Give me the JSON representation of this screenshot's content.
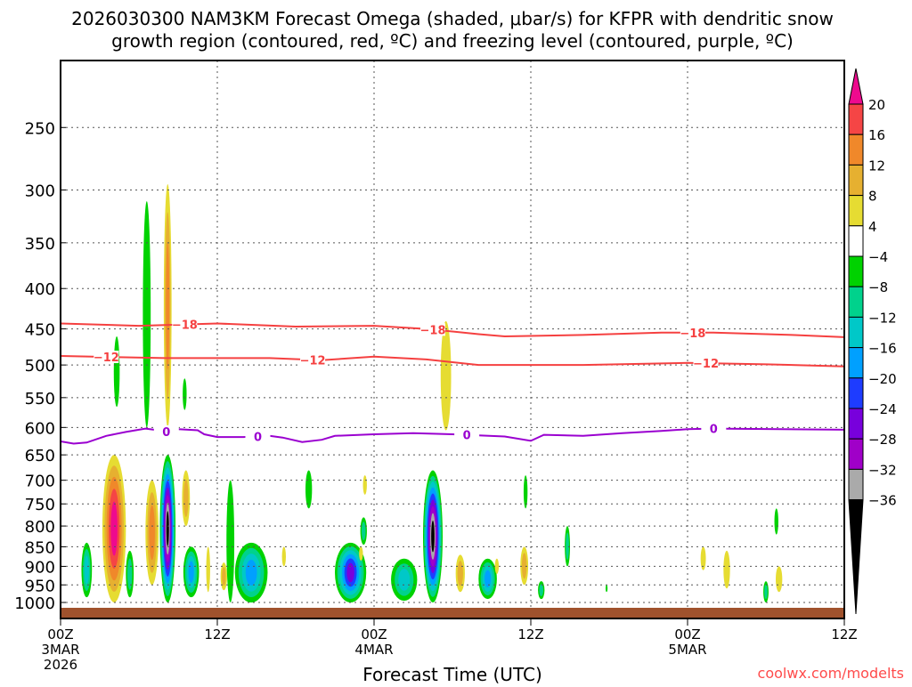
{
  "chart_data": {
    "type": "heatmap",
    "title_line1": "2026030300 NAM3KM Forecast Omega (shaded, μbar/s) for KFPR with dendritic snow",
    "title_line2": "growth region (contoured, red, ºC) and freezing level (contoured, purple, ºC)",
    "xlabel": "Forecast Time (UTC)",
    "xlim_hours": [
      0,
      60
    ],
    "ylim_pressure": [
      1048,
      206
    ],
    "y_ticks": [
      250,
      300,
      350,
      400,
      450,
      500,
      550,
      600,
      650,
      700,
      750,
      800,
      850,
      900,
      950,
      1000
    ],
    "x_ticks": [
      {
        "h": 0,
        "l1": "00Z",
        "l2": "3MAR",
        "l3": "2026"
      },
      {
        "h": 12,
        "l1": "12Z"
      },
      {
        "h": 24,
        "l1": "00Z",
        "l2": "4MAR"
      },
      {
        "h": 36,
        "l1": "12Z"
      },
      {
        "h": 48,
        "l1": "00Z",
        "l2": "5MAR"
      },
      {
        "h": 60,
        "l1": "12Z"
      }
    ],
    "colorbar": {
      "labels": [
        "20",
        "16",
        "12",
        "8",
        "4",
        "-4",
        "-8",
        "-12",
        "-16",
        "-20",
        "-24",
        "-28",
        "-32",
        "-36"
      ],
      "colors": [
        "#ee0a8e",
        "#f54545",
        "#f0882a",
        "#e6b030",
        "#e6dc32",
        "#ffffff",
        "#00d200",
        "#00d28c",
        "#00c8c8",
        "#00a0ff",
        "#1e3cff",
        "#7800dc",
        "#a000c8",
        "#aaaaaa",
        "#000000"
      ]
    },
    "omega_features": [
      {
        "t": 4.1,
        "p1": 650,
        "p2": 1000,
        "w": 1.8,
        "peak": 20
      },
      {
        "t": 2.0,
        "p1": 840,
        "p2": 985,
        "w": 0.8,
        "peak": -12
      },
      {
        "t": 4.3,
        "p1": 460,
        "p2": 565,
        "w": 0.45,
        "peak": -4
      },
      {
        "t": 5.3,
        "p1": 860,
        "p2": 985,
        "w": 0.6,
        "peak": -8
      },
      {
        "t": 6.6,
        "p1": 310,
        "p2": 600,
        "w": 0.6,
        "peak": -4
      },
      {
        "t": 7.0,
        "p1": 700,
        "p2": 950,
        "w": 1.0,
        "peak": 12
      },
      {
        "t": 8.2,
        "p1": 295,
        "p2": 600,
        "w": 0.6,
        "peak": 12
      },
      {
        "t": 8.2,
        "p1": 650,
        "p2": 1000,
        "w": 1.2,
        "peak": -36
      },
      {
        "t": 9.6,
        "p1": 680,
        "p2": 800,
        "w": 0.6,
        "peak": 8
      },
      {
        "t": 9.5,
        "p1": 520,
        "p2": 570,
        "w": 0.3,
        "peak": -4
      },
      {
        "t": 10.0,
        "p1": 850,
        "p2": 985,
        "w": 1.2,
        "peak": -16
      },
      {
        "t": 11.3,
        "p1": 850,
        "p2": 970,
        "w": 0.3,
        "peak": 4
      },
      {
        "t": 12.5,
        "p1": 890,
        "p2": 965,
        "w": 0.5,
        "peak": 8
      },
      {
        "t": 13.0,
        "p1": 700,
        "p2": 1000,
        "w": 0.6,
        "peak": -4
      },
      {
        "t": 14.6,
        "p1": 840,
        "p2": 1000,
        "w": 2.5,
        "peak": -16
      },
      {
        "t": 17.1,
        "p1": 850,
        "p2": 900,
        "w": 0.3,
        "peak": 4
      },
      {
        "t": 19.0,
        "p1": 680,
        "p2": 760,
        "w": 0.5,
        "peak": -4
      },
      {
        "t": 22.2,
        "p1": 840,
        "p2": 1000,
        "w": 2.4,
        "peak": -24
      },
      {
        "t": 23.0,
        "p1": 850,
        "p2": 885,
        "w": 0.3,
        "peak": 4
      },
      {
        "t": 23.3,
        "p1": 690,
        "p2": 730,
        "w": 0.3,
        "peak": 4
      },
      {
        "t": 23.2,
        "p1": 780,
        "p2": 845,
        "w": 0.5,
        "peak": -8
      },
      {
        "t": 26.3,
        "p1": 880,
        "p2": 995,
        "w": 2.0,
        "peak": -12
      },
      {
        "t": 28.5,
        "p1": 680,
        "p2": 1000,
        "w": 1.5,
        "peak": -36
      },
      {
        "t": 29.5,
        "p1": 440,
        "p2": 605,
        "w": 0.8,
        "peak": 4
      },
      {
        "t": 30.6,
        "p1": 870,
        "p2": 970,
        "w": 0.7,
        "peak": 8
      },
      {
        "t": 32.7,
        "p1": 880,
        "p2": 990,
        "w": 1.4,
        "peak": -16
      },
      {
        "t": 33.4,
        "p1": 880,
        "p2": 920,
        "w": 0.3,
        "peak": 4
      },
      {
        "t": 35.5,
        "p1": 850,
        "p2": 950,
        "w": 0.6,
        "peak": 8
      },
      {
        "t": 35.6,
        "p1": 690,
        "p2": 760,
        "w": 0.3,
        "peak": -4
      },
      {
        "t": 36.8,
        "p1": 940,
        "p2": 990,
        "w": 0.5,
        "peak": -8
      },
      {
        "t": 38.8,
        "p1": 800,
        "p2": 900,
        "w": 0.4,
        "peak": -8
      },
      {
        "t": 41.8,
        "p1": 950,
        "p2": 970,
        "w": 0.15,
        "peak": -4
      },
      {
        "t": 49.2,
        "p1": 850,
        "p2": 910,
        "w": 0.4,
        "peak": 4
      },
      {
        "t": 51.0,
        "p1": 860,
        "p2": 960,
        "w": 0.5,
        "peak": 4
      },
      {
        "t": 54.8,
        "p1": 760,
        "p2": 820,
        "w": 0.3,
        "peak": -4
      },
      {
        "t": 54.0,
        "p1": 940,
        "p2": 1000,
        "w": 0.4,
        "peak": -8
      },
      {
        "t": 55.0,
        "p1": 900,
        "p2": 970,
        "w": 0.5,
        "peak": 4
      }
    ],
    "contours": [
      {
        "name": "-18",
        "color": "#f54040",
        "points": [
          [
            0,
            443
          ],
          [
            6,
            446
          ],
          [
            12,
            443
          ],
          [
            18,
            447
          ],
          [
            24,
            446
          ],
          [
            28,
            450
          ],
          [
            32,
            457
          ],
          [
            34,
            460
          ],
          [
            40,
            458
          ],
          [
            46,
            455
          ],
          [
            50,
            455
          ],
          [
            56,
            458
          ],
          [
            60,
            461
          ]
        ],
        "label_hours": [
          9.5,
          28.5,
          48.4
        ]
      },
      {
        "name": "-12",
        "color": "#f54040",
        "points": [
          [
            0,
            487
          ],
          [
            8,
            490
          ],
          [
            16,
            490
          ],
          [
            20,
            493
          ],
          [
            24,
            488
          ],
          [
            28,
            492
          ],
          [
            32,
            500
          ],
          [
            40,
            500
          ],
          [
            48,
            497
          ],
          [
            54,
            499
          ],
          [
            60,
            502
          ]
        ],
        "label_hours": [
          3.5,
          19.3,
          49.4
        ]
      },
      {
        "name": "0",
        "color": "#9a00d0",
        "points": [
          [
            0,
            625
          ],
          [
            1,
            629
          ],
          [
            2,
            627
          ],
          [
            3.5,
            615
          ],
          [
            5,
            608
          ],
          [
            6.5,
            602
          ],
          [
            7.5,
            605
          ],
          [
            8.3,
            608
          ],
          [
            9,
            603
          ],
          [
            10.5,
            605
          ],
          [
            11,
            612
          ],
          [
            12,
            617
          ],
          [
            14,
            617
          ],
          [
            16,
            615
          ],
          [
            17,
            618
          ],
          [
            18.5,
            626
          ],
          [
            20,
            622
          ],
          [
            21,
            615
          ],
          [
            24,
            612
          ],
          [
            27,
            610
          ],
          [
            30,
            612
          ],
          [
            34,
            616
          ],
          [
            36,
            624
          ],
          [
            37,
            613
          ],
          [
            40,
            615
          ],
          [
            43,
            610
          ],
          [
            46,
            606
          ],
          [
            48,
            603
          ],
          [
            50,
            602
          ],
          [
            55,
            603
          ],
          [
            60,
            604
          ]
        ],
        "label_hours": [
          8.1,
          15.1,
          31.1,
          50.0
        ]
      }
    ],
    "watermark": "coolwx.com/modelts"
  }
}
